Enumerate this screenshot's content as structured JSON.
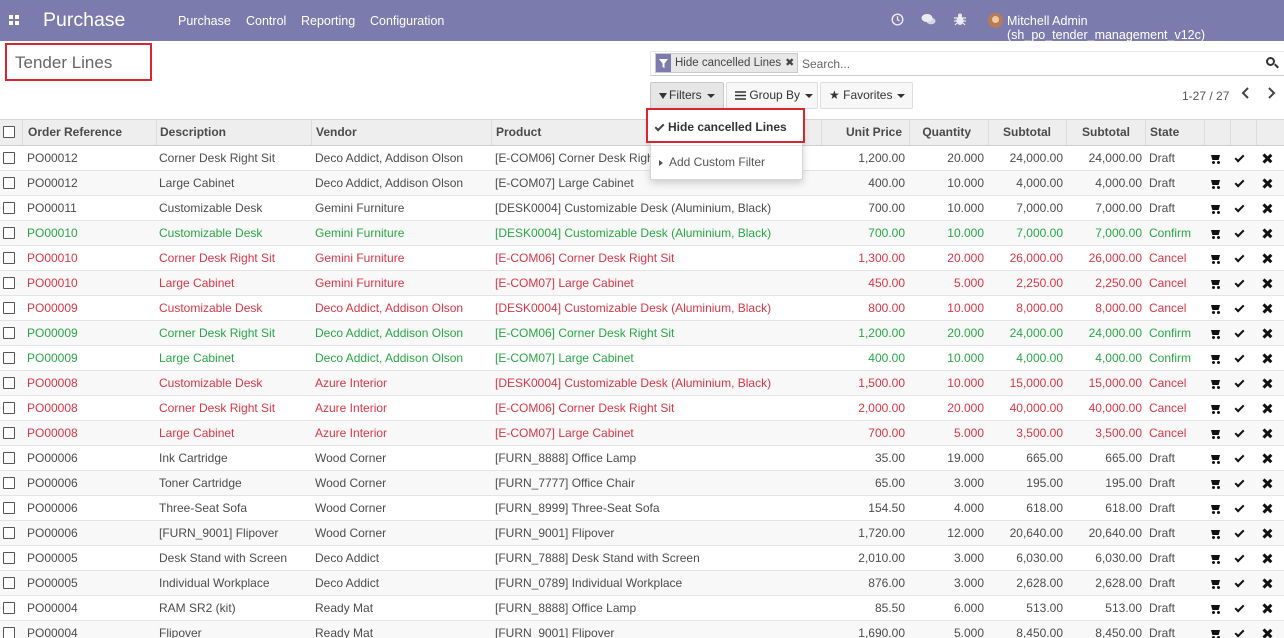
{
  "navbar": {
    "app_name": "Purchase",
    "menus": [
      "Purchase",
      "Control",
      "Reporting",
      "Configuration"
    ],
    "icons": [
      "clock-icon",
      "chat-icon",
      "bug-icon"
    ],
    "user": "Mitchell Admin (sh_po_tender_management_v12c)",
    "bg_color": "#7c7bad"
  },
  "page": {
    "title": "Tender Lines"
  },
  "search": {
    "facet_label": "Hide cancelled Lines",
    "facet_close": "✖",
    "placeholder": "Search..."
  },
  "controls": {
    "filters": "Filters",
    "group_by": "Group By",
    "favorites": "Favorites",
    "pager": "1-27 / 27"
  },
  "filters_dropdown": {
    "item_checked": "Hide cancelled Lines",
    "add_custom": "Add Custom Filter"
  },
  "table": {
    "columns": [
      "Order Reference",
      "Description",
      "Vendor",
      "Product",
      "Unit Price",
      "Quantity",
      "Subtotal",
      "Subtotal",
      "State"
    ],
    "state_colors": {
      "Draft": "#4c4c4c",
      "Confirm": "#28a745",
      "Cancel": "#dc3545"
    },
    "rows": [
      {
        "ref": "PO00012",
        "desc": "Corner Desk Right Sit",
        "vendor": "Deco Addict, Addison Olson",
        "product": "[E-COM06] Corner Desk Right Sit",
        "price": "1,200.00",
        "qty": "20.000",
        "sub1": "24,000.00",
        "sub2": "24,000.00",
        "state": "Draft"
      },
      {
        "ref": "PO00012",
        "desc": "Large Cabinet",
        "vendor": "Deco Addict, Addison Olson",
        "product": "[E-COM07] Large Cabinet",
        "price": "400.00",
        "qty": "10.000",
        "sub1": "4,000.00",
        "sub2": "4,000.00",
        "state": "Draft"
      },
      {
        "ref": "PO00011",
        "desc": "Customizable Desk",
        "vendor": "Gemini Furniture",
        "product": "[DESK0004] Customizable Desk (Aluminium, Black)",
        "price": "700.00",
        "qty": "10.000",
        "sub1": "7,000.00",
        "sub2": "7,000.00",
        "state": "Draft"
      },
      {
        "ref": "PO00010",
        "desc": "Customizable Desk",
        "vendor": "Gemini Furniture",
        "product": "[DESK0004] Customizable Desk (Aluminium, Black)",
        "price": "700.00",
        "qty": "10.000",
        "sub1": "7,000.00",
        "sub2": "7,000.00",
        "state": "Confirm"
      },
      {
        "ref": "PO00010",
        "desc": "Corner Desk Right Sit",
        "vendor": "Gemini Furniture",
        "product": "[E-COM06] Corner Desk Right Sit",
        "price": "1,300.00",
        "qty": "20.000",
        "sub1": "26,000.00",
        "sub2": "26,000.00",
        "state": "Cancel"
      },
      {
        "ref": "PO00010",
        "desc": "Large Cabinet",
        "vendor": "Gemini Furniture",
        "product": "[E-COM07] Large Cabinet",
        "price": "450.00",
        "qty": "5.000",
        "sub1": "2,250.00",
        "sub2": "2,250.00",
        "state": "Cancel"
      },
      {
        "ref": "PO00009",
        "desc": "Customizable Desk",
        "vendor": "Deco Addict, Addison Olson",
        "product": "[DESK0004] Customizable Desk (Aluminium, Black)",
        "price": "800.00",
        "qty": "10.000",
        "sub1": "8,000.00",
        "sub2": "8,000.00",
        "state": "Cancel"
      },
      {
        "ref": "PO00009",
        "desc": "Corner Desk Right Sit",
        "vendor": "Deco Addict, Addison Olson",
        "product": "[E-COM06] Corner Desk Right Sit",
        "price": "1,200.00",
        "qty": "20.000",
        "sub1": "24,000.00",
        "sub2": "24,000.00",
        "state": "Confirm"
      },
      {
        "ref": "PO00009",
        "desc": "Large Cabinet",
        "vendor": "Deco Addict, Addison Olson",
        "product": "[E-COM07] Large Cabinet",
        "price": "400.00",
        "qty": "10.000",
        "sub1": "4,000.00",
        "sub2": "4,000.00",
        "state": "Confirm"
      },
      {
        "ref": "PO00008",
        "desc": "Customizable Desk",
        "vendor": "Azure Interior",
        "product": "[DESK0004] Customizable Desk (Aluminium, Black)",
        "price": "1,500.00",
        "qty": "10.000",
        "sub1": "15,000.00",
        "sub2": "15,000.00",
        "state": "Cancel"
      },
      {
        "ref": "PO00008",
        "desc": "Corner Desk Right Sit",
        "vendor": "Azure Interior",
        "product": "[E-COM06] Corner Desk Right Sit",
        "price": "2,000.00",
        "qty": "20.000",
        "sub1": "40,000.00",
        "sub2": "40,000.00",
        "state": "Cancel"
      },
      {
        "ref": "PO00008",
        "desc": "Large Cabinet",
        "vendor": "Azure Interior",
        "product": "[E-COM07] Large Cabinet",
        "price": "700.00",
        "qty": "5.000",
        "sub1": "3,500.00",
        "sub2": "3,500.00",
        "state": "Cancel"
      },
      {
        "ref": "PO00006",
        "desc": "Ink Cartridge",
        "vendor": "Wood Corner",
        "product": "[FURN_8888] Office Lamp",
        "price": "35.00",
        "qty": "19.000",
        "sub1": "665.00",
        "sub2": "665.00",
        "state": "Draft"
      },
      {
        "ref": "PO00006",
        "desc": "Toner Cartridge",
        "vendor": "Wood Corner",
        "product": "[FURN_7777] Office Chair",
        "price": "65.00",
        "qty": "3.000",
        "sub1": "195.00",
        "sub2": "195.00",
        "state": "Draft"
      },
      {
        "ref": "PO00006",
        "desc": "Three-Seat Sofa",
        "vendor": "Wood Corner",
        "product": "[FURN_8999] Three-Seat Sofa",
        "price": "154.50",
        "qty": "4.000",
        "sub1": "618.00",
        "sub2": "618.00",
        "state": "Draft"
      },
      {
        "ref": "PO00006",
        "desc": "[FURN_9001] Flipover",
        "vendor": "Wood Corner",
        "product": "[FURN_9001] Flipover",
        "price": "1,720.00",
        "qty": "12.000",
        "sub1": "20,640.00",
        "sub2": "20,640.00",
        "state": "Draft"
      },
      {
        "ref": "PO00005",
        "desc": "Desk Stand with Screen",
        "vendor": "Deco Addict",
        "product": "[FURN_7888] Desk Stand with Screen",
        "price": "2,010.00",
        "qty": "3.000",
        "sub1": "6,030.00",
        "sub2": "6,030.00",
        "state": "Draft"
      },
      {
        "ref": "PO00005",
        "desc": "Individual Workplace",
        "vendor": "Deco Addict",
        "product": "[FURN_0789] Individual Workplace",
        "price": "876.00",
        "qty": "3.000",
        "sub1": "2,628.00",
        "sub2": "2,628.00",
        "state": "Draft"
      },
      {
        "ref": "PO00004",
        "desc": "RAM SR2 (kit)",
        "vendor": "Ready Mat",
        "product": "[FURN_8888] Office Lamp",
        "price": "85.50",
        "qty": "6.000",
        "sub1": "513.00",
        "sub2": "513.00",
        "state": "Draft"
      },
      {
        "ref": "PO00004",
        "desc": "Flipover",
        "vendor": "Ready Mat",
        "product": "[FURN_9001] Flipover",
        "price": "1,690.00",
        "qty": "5.000",
        "sub1": "8,450.00",
        "sub2": "8,450.00",
        "state": "Draft"
      }
    ]
  }
}
